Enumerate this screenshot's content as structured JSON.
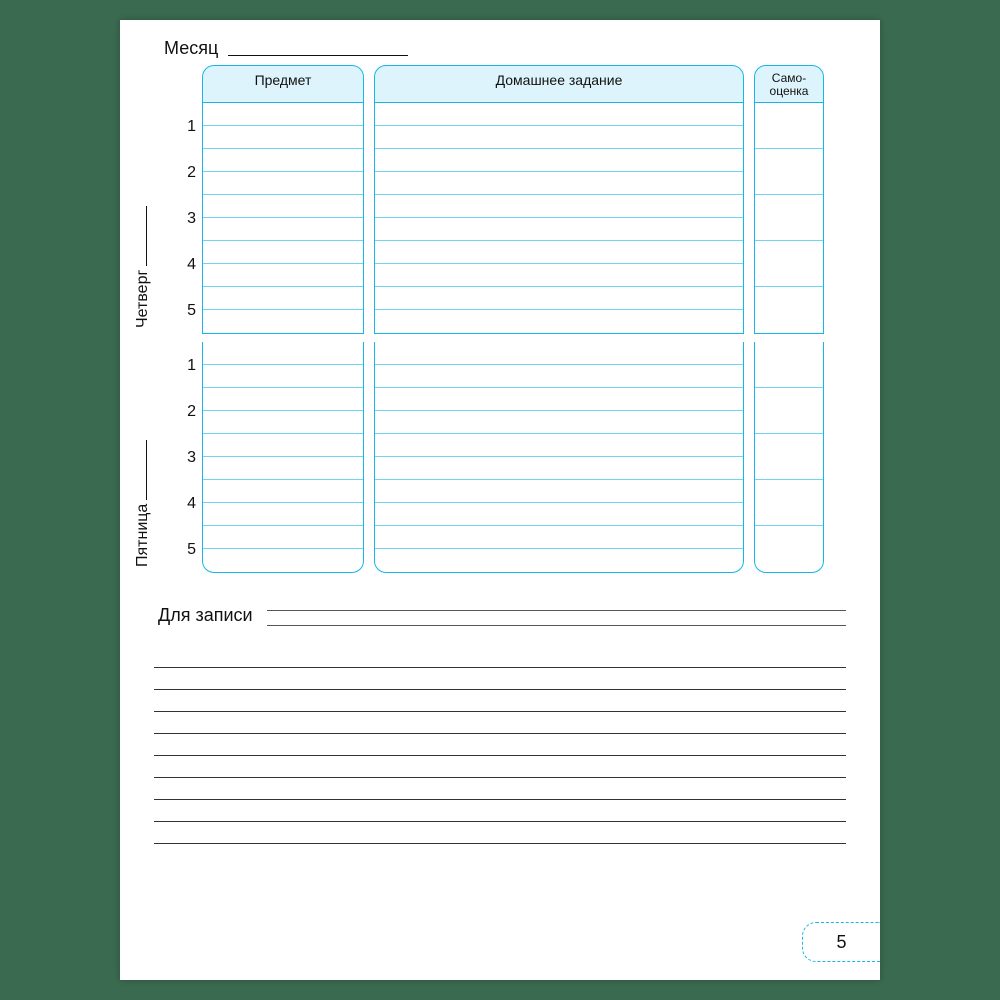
{
  "month_label": "Месяц",
  "headers": {
    "subject": "Предмет",
    "homework": "Домашнее задание",
    "self1": "Само-",
    "self2": "оценка"
  },
  "days": [
    {
      "name": "Четверг",
      "rows": [
        "1",
        "2",
        "3",
        "4",
        "5"
      ]
    },
    {
      "name": "Пятница",
      "rows": [
        "1",
        "2",
        "3",
        "4",
        "5"
      ]
    }
  ],
  "notes_label": "Для записи",
  "page_number": "5"
}
